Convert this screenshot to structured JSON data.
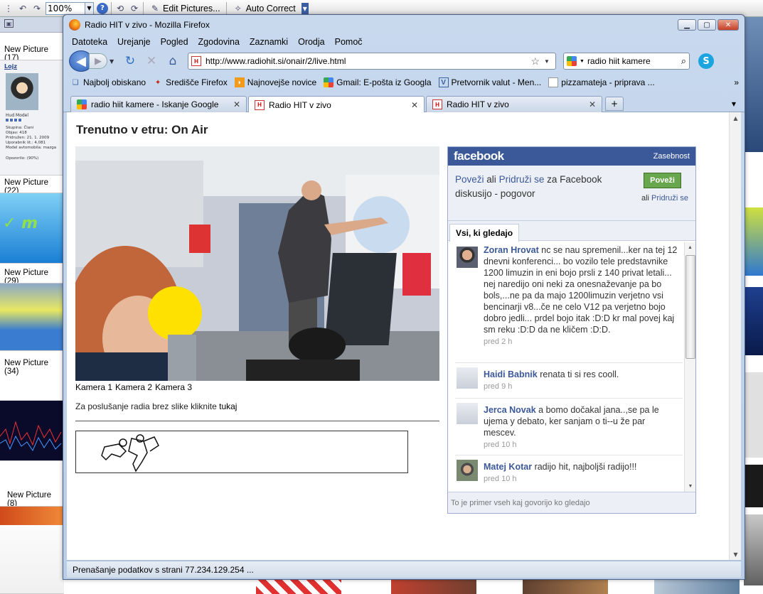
{
  "toolbar": {
    "zoom": "100%",
    "edit_pictures": "Edit Pictures...",
    "auto_correct": "Auto Correct"
  },
  "left_panel": {
    "items": [
      {
        "label": "New Picture (17)"
      },
      {
        "label": "New Picture (22)"
      },
      {
        "label": "New Picture (29)"
      },
      {
        "label": "New Picture (34)"
      },
      {
        "label": "New Picture (8)"
      }
    ],
    "forum": {
      "username": "Lojz",
      "rank": "Hud Model",
      "group": "Skupina: Člani",
      "posts": "Objav: 418",
      "joined": "Pridružen: 21. 1. 2009",
      "user_number": "Uporabnik št.: 4,081",
      "car": "Model avtomobila: mazga",
      "warning": "Opozorilo: (90%)"
    }
  },
  "window": {
    "title": "Radio HIT v zivo - Mozilla Firefox"
  },
  "menu": [
    "Datoteka",
    "Urejanje",
    "Pogled",
    "Zgodovina",
    "Zaznamki",
    "Orodja",
    "Pomoč"
  ],
  "nav": {
    "url": "http://www.radiohit.si/onair/2/live.html",
    "search": "radio hiit kamere"
  },
  "bookmarks": [
    {
      "label": "Najbolj obiskano",
      "icon": "bookmark-page-icon"
    },
    {
      "label": "Središče Firefox",
      "icon": "firefox-hub-icon"
    },
    {
      "label": "Najnovejše novice",
      "icon": "rss-icon"
    },
    {
      "label": "Gmail: E-pošta iz Googla",
      "icon": "google-icon"
    },
    {
      "label": "Pretvornik valut - Men...",
      "icon": "currency-icon"
    },
    {
      "label": "pizzamateja - priprava ...",
      "icon": "page-icon"
    }
  ],
  "tabs": [
    {
      "label": "radio hiit kamere - Iskanje Google",
      "active": false
    },
    {
      "label": "Radio HIT v zivo",
      "active": true
    },
    {
      "label": "Radio HIT v zivo",
      "active": false
    }
  ],
  "page": {
    "heading": "Trenutno v etru: On Air",
    "cameras": [
      "Kamera 1",
      "Kamera 2",
      "Kamera 3"
    ],
    "listen_text": "Za poslušanje radia brez slike kliknite",
    "listen_link": "tukaj"
  },
  "facebook": {
    "logo": "facebook",
    "privacy": "Zasebnost",
    "connect_link": "Poveži",
    "or": "ali",
    "join_link": "Pridruži se",
    "connect_suffix": "za Facebook diskusijo - pogovor",
    "connect_button": "Poveži",
    "or_join_prefix": "ali",
    "or_join_link": "Pridruži se",
    "tab": "Vsi, ki gledajo",
    "posts": [
      {
        "name": "Zoran Hrovat",
        "text": "nc se nau spremenil...ker na tej 12 dnevni konferenci... bo vozilo tele predstavnike 1200 limuzin in eni bojo prsli z 140 privat letali... nej naredijo oni neki za onesnaževanje pa bo bols,...ne pa da majo 1200limuzin verjetno vsi bencinarji v8...če ne celo V12 pa verjetno bojo dobro jedli... prdel bojo itak :D:D kr mal povej kaj sm reku :D:D da ne kličem :D:D.",
        "time": "pred 2 h"
      },
      {
        "name": "Haidi Babnik",
        "text": "renata ti si res cooll.",
        "time": "pred 9 h"
      },
      {
        "name": "Jerca Novak",
        "text": "a bomo dočakal jana..,se pa le ujema y debato, ker sanjam o ti--u že par mescev.",
        "time": "pred 10 h"
      },
      {
        "name": "Matej Kotar",
        "text": "radijo hit, najboljši radijo!!!",
        "time": "pred 10 h"
      }
    ],
    "footer": "To je primer vseh kaj govorijo ko gledajo"
  },
  "status": "Prenašanje podatkov s strani 77.234.129.254 ..."
}
